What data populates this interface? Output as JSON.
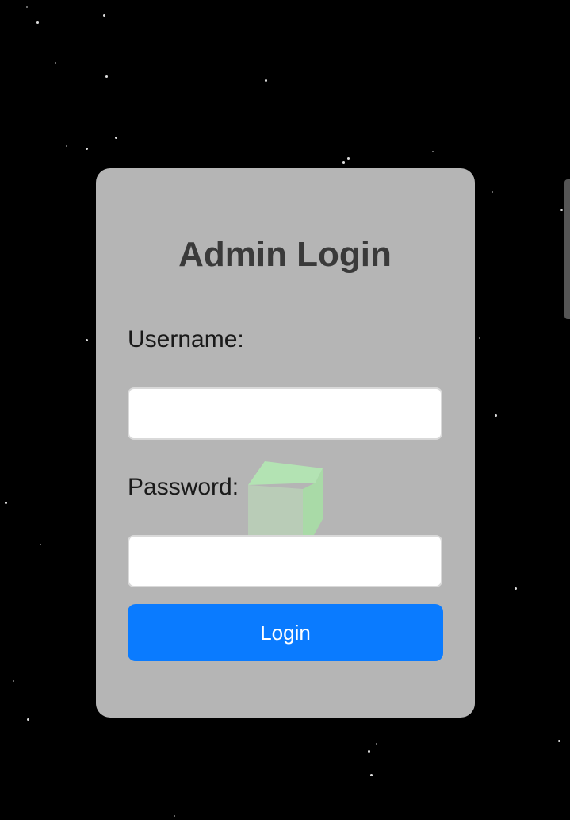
{
  "login_form": {
    "title": "Admin Login",
    "username_label": "Username:",
    "username_value": "",
    "password_label": "Password:",
    "password_value": "",
    "login_button_label": "Login"
  },
  "colors": {
    "background": "#000000",
    "card": "#b5b5b5",
    "title": "#3a3a3a",
    "button": "#0a7bff",
    "button_text": "#ffffff",
    "cube": "#a8dca8"
  },
  "decorations": {
    "background_icon": "starfield",
    "center_graphic_icon": "green-cube"
  }
}
